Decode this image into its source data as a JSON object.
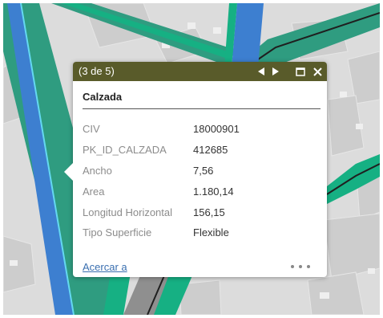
{
  "colors": {
    "map_background": "#dcdcdc",
    "building_fill": "#c9c9c9",
    "road_teal": "#2f9c80",
    "road_green": "#16b083",
    "road_blue": "#3d7fd0",
    "road_cyan": "#64d8f0",
    "road_dark": "#1f1f1f",
    "road_gray": "#8f8f8f",
    "popup_header": "#595b2a",
    "link": "#3a6fb0"
  },
  "popup": {
    "feature_count": "(3 de 5)",
    "title": "Calzada",
    "controls": {
      "prev_icon": "triangle-left-icon",
      "next_icon": "triangle-right-icon",
      "maximize_icon": "maximize-icon",
      "close_icon": "close-icon"
    },
    "attributes": [
      {
        "field": "CIV",
        "value": "18000901"
      },
      {
        "field": "PK_ID_CALZADA",
        "value": "412685"
      },
      {
        "field": "Ancho",
        "value": "7,56"
      },
      {
        "field": "Area",
        "value": "1.180,14"
      },
      {
        "field": "Longitud Horizontal",
        "value": "156,15"
      },
      {
        "field": "Tipo Superficie",
        "value": "Flexible"
      }
    ],
    "zoom_link": "Acercar a",
    "more_icon": "more-dots-icon"
  }
}
